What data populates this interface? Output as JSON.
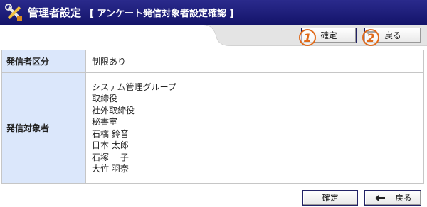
{
  "header": {
    "title": "管理者設定",
    "subtitle": "[ アンケート発信対象者設定確認 ]",
    "icon": "tools-icon",
    "bar_color": "#1e1e7a"
  },
  "toolbar_top": {
    "confirm_label": "確定",
    "back_label": "戻る",
    "marker_1": "1",
    "marker_2": "2"
  },
  "details": {
    "sender_category_label": "発信者区分",
    "sender_category_value": "制限あり",
    "recipients_label": "発信対象者",
    "recipients": [
      "システム管理グループ",
      "取締役",
      "社外取締役",
      "秘書室",
      "石橋 鈴音",
      "日本 太郎",
      "石塚 一子",
      "大竹 羽奈"
    ]
  },
  "toolbar_bottom": {
    "confirm_label": "確定",
    "back_label": "戻る"
  },
  "colors": {
    "header_cell_bg": "#dbe7fb",
    "marker": "#e06a1a"
  }
}
